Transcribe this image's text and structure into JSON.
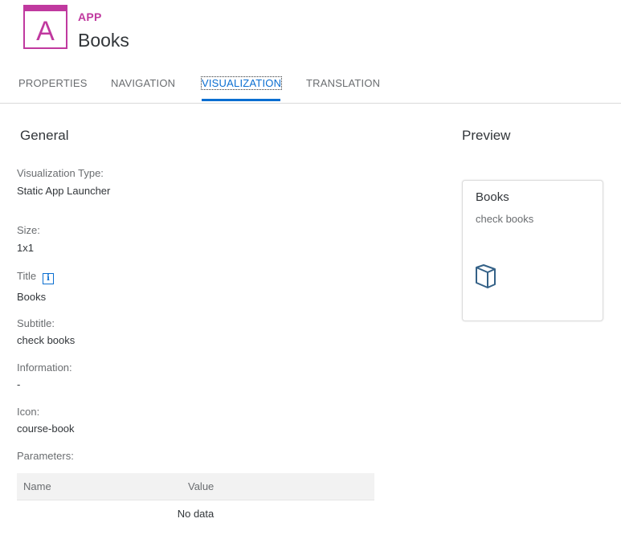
{
  "header": {
    "app_icon_letter": "A",
    "app_type": "APP",
    "title": "Books"
  },
  "tabs": [
    {
      "label": "PROPERTIES",
      "active": false
    },
    {
      "label": "NAVIGATION",
      "active": false
    },
    {
      "label": "VISUALIZATION",
      "active": true
    },
    {
      "label": "TRANSLATION",
      "active": false
    }
  ],
  "general": {
    "section_title": "General",
    "fields": {
      "visualization_type": {
        "label": "Visualization Type:",
        "value": "Static App Launcher"
      },
      "size": {
        "label": "Size:",
        "value": "1x1"
      },
      "title": {
        "label": "Title",
        "value": "Books"
      },
      "subtitle": {
        "label": "Subtitle:",
        "value": "check books"
      },
      "information": {
        "label": "Information:",
        "value": "-"
      },
      "icon": {
        "label": "Icon:",
        "value": "course-book"
      },
      "parameters": {
        "label": "Parameters:"
      }
    },
    "parameters_table": {
      "columns": [
        "Name",
        "Value"
      ],
      "empty_text": "No data"
    }
  },
  "preview": {
    "section_title": "Preview",
    "tile": {
      "title": "Books",
      "subtitle": "check books",
      "icon": "course-book-icon"
    }
  },
  "colors": {
    "app_accent": "#c0399f",
    "active_tab": "#0a6ed1",
    "icon_blue": "#346187"
  }
}
